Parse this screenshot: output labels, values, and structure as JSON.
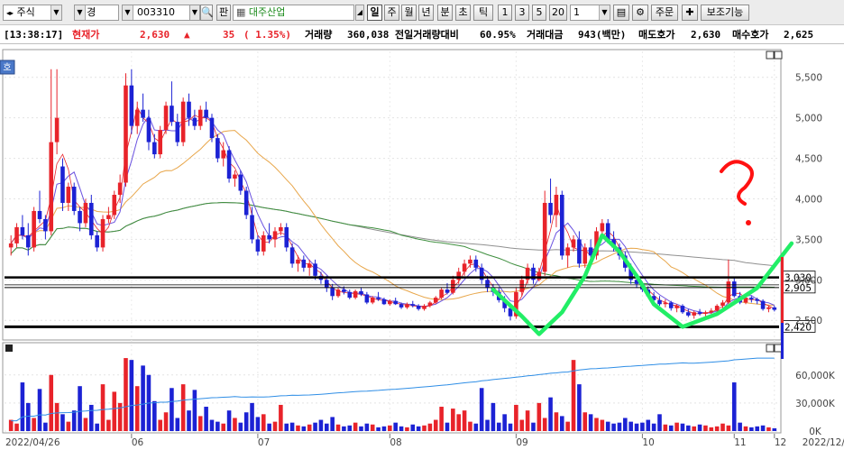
{
  "toolbar": {
    "market": "주식",
    "change_label": "변경",
    "code": "003310",
    "pan_label": "판",
    "name": "대주산업",
    "periods": [
      "일",
      "주",
      "월",
      "년",
      "분",
      "초",
      "틱"
    ],
    "active_period": "일",
    "counts": [
      "1",
      "3",
      "5",
      "20"
    ],
    "count_value": "1",
    "order_button": "주문",
    "aux_button": "보조기능"
  },
  "infobar": {
    "time": "[13:38:17]",
    "price_label": "현재가",
    "price": "2,630",
    "change": "35",
    "change_pct": "( 1.35%)",
    "volume_label": "거래량",
    "volume": "360,038",
    "vol_ratio_label": "전일거래량대비",
    "vol_ratio": "60.95%",
    "amount_label": "거래대금",
    "amount": "943(백만)",
    "ask_label": "매도호가",
    "ask": "2,630",
    "bid_label": "매수호가",
    "bid": "2,625"
  },
  "colors": {
    "up": "#e8232a",
    "down": "#1c22d4",
    "ma5": "#6a52e0",
    "ma20": "#e8a64a",
    "ma60": "#3f8f3f",
    "ma120": "#909090",
    "vol_line": "#2f8ee6",
    "annotation": "#22ee66",
    "question": "#ff1111"
  },
  "chart_data": {
    "type": "candlestick",
    "ylim": [
      2280,
      5820
    ],
    "y_ticks": [
      "5,500",
      "5,000",
      "4,500",
      "4,000",
      "3,500",
      "3,000",
      "2,500"
    ],
    "y_tick_values": [
      5500,
      5000,
      4500,
      4000,
      3500,
      3000,
      2500
    ],
    "x_labels": [
      "2022/04/26",
      "06",
      "07",
      "08",
      "09",
      "10",
      "11",
      "12",
      "2022/12/08"
    ],
    "level_labels": [
      "3,030",
      "2,905",
      "2,420"
    ],
    "level_values": [
      3030,
      2905,
      2420
    ],
    "volume_ticks": [
      "60,000K",
      "30,000K",
      "0K"
    ],
    "volume_tick_values": [
      60000,
      30000,
      0
    ],
    "volume_max": 80000,
    "candles": [
      [
        3400,
        3550,
        3300,
        3450
      ],
      [
        3450,
        3700,
        3400,
        3650
      ],
      [
        3650,
        3800,
        3500,
        3550
      ],
      [
        3550,
        3700,
        3300,
        3400
      ],
      [
        3400,
        3900,
        3350,
        3850
      ],
      [
        3850,
        4100,
        3700,
        3750
      ],
      [
        3750,
        3800,
        3500,
        3600
      ],
      [
        3600,
        5600,
        3550,
        4700
      ],
      [
        4700,
        5600,
        4550,
        5000
      ],
      [
        4400,
        4500,
        3850,
        3950
      ],
      [
        3950,
        4200,
        3850,
        4150
      ],
      [
        4150,
        4200,
        3800,
        3850
      ],
      [
        3850,
        3900,
        3600,
        3700
      ],
      [
        3700,
        4000,
        3650,
        3950
      ],
      [
        3950,
        4050,
        3500,
        3550
      ],
      [
        3550,
        3600,
        3350,
        3400
      ],
      [
        3400,
        3800,
        3350,
        3750
      ],
      [
        3750,
        3900,
        3700,
        3800
      ],
      [
        3800,
        4100,
        3750,
        4050
      ],
      [
        4050,
        4300,
        3950,
        4200
      ],
      [
        4200,
        5550,
        4150,
        5400
      ],
      [
        5400,
        5600,
        4800,
        4900
      ],
      [
        4900,
        5200,
        4800,
        5100
      ],
      [
        5100,
        5300,
        4950,
        5000
      ],
      [
        5000,
        5100,
        4600,
        4700
      ],
      [
        4700,
        4800,
        4500,
        4550
      ],
      [
        4550,
        4900,
        4500,
        4850
      ],
      [
        4850,
        5200,
        4800,
        5150
      ],
      [
        5150,
        5450,
        4900,
        4950
      ],
      [
        4950,
        5050,
        4650,
        4700
      ],
      [
        4700,
        5250,
        4650,
        5200
      ],
      [
        5200,
        5300,
        4900,
        5000
      ],
      [
        5000,
        5100,
        4850,
        4900
      ],
      [
        4900,
        5150,
        4850,
        5100
      ],
      [
        5100,
        5200,
        4950,
        5000
      ],
      [
        5000,
        5050,
        4700,
        4750
      ],
      [
        4750,
        4800,
        4450,
        4500
      ],
      [
        4500,
        4700,
        4400,
        4600
      ],
      [
        4600,
        4650,
        4200,
        4250
      ],
      [
        4250,
        4350,
        4150,
        4300
      ],
      [
        4300,
        4350,
        4050,
        4100
      ],
      [
        4100,
        4150,
        3750,
        3800
      ],
      [
        3800,
        3900,
        3450,
        3500
      ],
      [
        3500,
        3550,
        3300,
        3350
      ],
      [
        3350,
        3600,
        3300,
        3550
      ],
      [
        3550,
        3700,
        3450,
        3500
      ],
      [
        3500,
        3650,
        3400,
        3600
      ],
      [
        3600,
        3700,
        3550,
        3650
      ],
      [
        3650,
        3700,
        3350,
        3400
      ],
      [
        3400,
        3450,
        3150,
        3200
      ],
      [
        3200,
        3300,
        3100,
        3250
      ],
      [
        3250,
        3300,
        3100,
        3150
      ],
      [
        3150,
        3250,
        3050,
        3200
      ],
      [
        3200,
        3250,
        3000,
        3050
      ],
      [
        3050,
        3100,
        2950,
        3000
      ],
      [
        3000,
        3050,
        2850,
        2900
      ],
      [
        2900,
        2950,
        2750,
        2800
      ],
      [
        2800,
        2900,
        2780,
        2880
      ],
      [
        2880,
        2920,
        2820,
        2850
      ],
      [
        2850,
        2880,
        2760,
        2780
      ],
      [
        2780,
        2880,
        2760,
        2860
      ],
      [
        2860,
        2900,
        2800,
        2820
      ],
      [
        2820,
        2850,
        2700,
        2720
      ],
      [
        2720,
        2800,
        2700,
        2780
      ],
      [
        2780,
        2850,
        2740,
        2760
      ],
      [
        2760,
        2780,
        2690,
        2700
      ],
      [
        2700,
        2760,
        2680,
        2740
      ],
      [
        2740,
        2780,
        2690,
        2700
      ],
      [
        2700,
        2720,
        2640,
        2660
      ],
      [
        2660,
        2720,
        2640,
        2700
      ],
      [
        2700,
        2740,
        2660,
        2680
      ],
      [
        2680,
        2700,
        2620,
        2640
      ],
      [
        2640,
        2700,
        2620,
        2680
      ],
      [
        2680,
        2740,
        2660,
        2720
      ],
      [
        2720,
        2800,
        2700,
        2780
      ],
      [
        2780,
        2900,
        2760,
        2880
      ],
      [
        2880,
        2960,
        2820,
        2840
      ],
      [
        2840,
        3050,
        2820,
        3000
      ],
      [
        3000,
        3150,
        2950,
        3100
      ],
      [
        3100,
        3250,
        3050,
        3200
      ],
      [
        3200,
        3300,
        3150,
        3250
      ],
      [
        3250,
        3300,
        3100,
        3150
      ],
      [
        3150,
        3200,
        2950,
        3000
      ],
      [
        3000,
        3050,
        2850,
        2900
      ],
      [
        2900,
        2950,
        2800,
        2850
      ],
      [
        2850,
        2900,
        2720,
        2750
      ],
      [
        2750,
        2800,
        2600,
        2650
      ],
      [
        2650,
        2700,
        2500,
        2550
      ],
      [
        2550,
        2900,
        2520,
        2850
      ],
      [
        2850,
        3050,
        2800,
        3000
      ],
      [
        3000,
        3200,
        2950,
        3150
      ],
      [
        3150,
        3200,
        2950,
        3000
      ],
      [
        3000,
        3150,
        2980,
        3100
      ],
      [
        3100,
        4100,
        3050,
        3950
      ],
      [
        3950,
        4250,
        3700,
        3800
      ],
      [
        3800,
        4150,
        3650,
        4050
      ],
      [
        4050,
        4100,
        3250,
        3300
      ],
      [
        3300,
        3450,
        3150,
        3400
      ],
      [
        3400,
        3550,
        3350,
        3500
      ],
      [
        3500,
        3600,
        3150,
        3200
      ],
      [
        3200,
        3450,
        3150,
        3400
      ],
      [
        3400,
        3500,
        3250,
        3300
      ],
      [
        3300,
        3650,
        3250,
        3600
      ],
      [
        3600,
        3750,
        3500,
        3700
      ],
      [
        3700,
        3750,
        3450,
        3500
      ],
      [
        3500,
        3600,
        3350,
        3400
      ],
      [
        3400,
        3450,
        3250,
        3300
      ],
      [
        3300,
        3350,
        3100,
        3150
      ],
      [
        3150,
        3200,
        2950,
        3000
      ],
      [
        3000,
        3050,
        2900,
        2950
      ],
      [
        2950,
        2980,
        2850,
        2880
      ],
      [
        2880,
        2920,
        2780,
        2800
      ],
      [
        2800,
        2850,
        2720,
        2750
      ],
      [
        2750,
        2800,
        2680,
        2700
      ],
      [
        2700,
        2760,
        2660,
        2720
      ],
      [
        2720,
        2740,
        2620,
        2650
      ],
      [
        2650,
        2700,
        2600,
        2680
      ],
      [
        2680,
        2700,
        2580,
        2600
      ],
      [
        2600,
        2640,
        2540,
        2560
      ],
      [
        2560,
        2620,
        2520,
        2600
      ],
      [
        2600,
        2640,
        2560,
        2580
      ],
      [
        2580,
        2620,
        2540,
        2600
      ],
      [
        2600,
        2650,
        2580,
        2620
      ],
      [
        2620,
        2700,
        2600,
        2680
      ],
      [
        2680,
        2750,
        2650,
        2720
      ],
      [
        2720,
        3250,
        2700,
        2980
      ],
      [
        2980,
        3020,
        2780,
        2800
      ],
      [
        2800,
        2850,
        2700,
        2720
      ],
      [
        2720,
        2800,
        2700,
        2780
      ],
      [
        2780,
        2800,
        2720,
        2760
      ],
      [
        2760,
        2780,
        2700,
        2740
      ],
      [
        2740,
        2760,
        2620,
        2640
      ],
      [
        2640,
        2680,
        2600,
        2660
      ],
      [
        2660,
        2680,
        2610,
        2630
      ]
    ],
    "volume": [
      12000,
      8000,
      52000,
      30000,
      14000,
      45000,
      9000,
      60000,
      30000,
      18000,
      10000,
      22000,
      48000,
      14000,
      28000,
      8000,
      50000,
      12000,
      42000,
      30000,
      78000,
      76000,
      48000,
      70000,
      60000,
      32000,
      12000,
      20000,
      46000,
      14000,
      50000,
      22000,
      44000,
      16000,
      26000,
      12000,
      10000,
      8000,
      22000,
      14000,
      9000,
      20000,
      30000,
      15000,
      18000,
      8000,
      10000,
      28000,
      8000,
      9000,
      6000,
      5000,
      7000,
      9000,
      12000,
      8000,
      15000,
      7000,
      5000,
      6000,
      9000,
      5000,
      8000,
      7000,
      4000,
      5000,
      6000,
      9000,
      5000,
      4000,
      7000,
      5000,
      6000,
      8000,
      12000,
      26000,
      9000,
      24000,
      18000,
      22000,
      10000,
      8000,
      46000,
      12000,
      30000,
      9000,
      18000,
      8000,
      28000,
      12000,
      22000,
      9000,
      30000,
      14000,
      36000,
      20000,
      16000,
      10000,
      76000,
      50000,
      20000,
      18000,
      14000,
      12000,
      10000,
      8000,
      9000,
      14000,
      10000,
      8000,
      9000,
      12000,
      8000,
      18000,
      7000,
      6000,
      9000,
      8000,
      6000,
      5000,
      7000,
      6000,
      4000,
      5000,
      8000,
      6000,
      52000,
      9000,
      5000,
      4000,
      5000,
      6000,
      4000,
      3000
    ]
  }
}
